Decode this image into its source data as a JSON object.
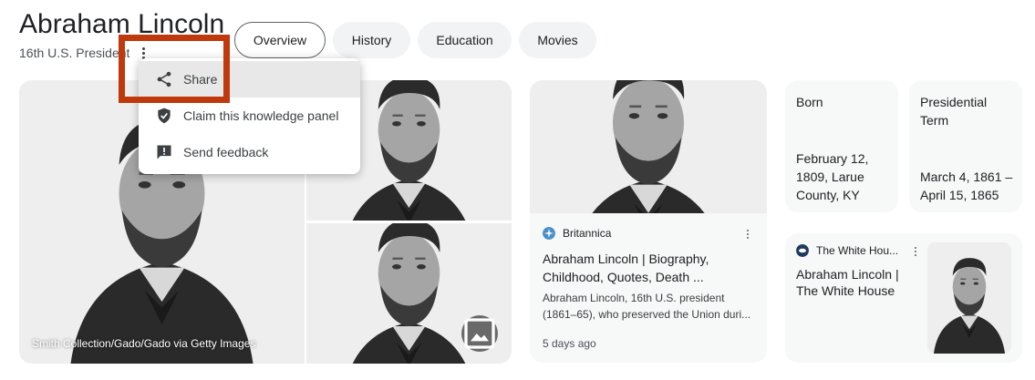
{
  "header": {
    "title": "Abraham Lincoln",
    "subtitle": "16th U.S. President",
    "tabs": [
      {
        "label": "Overview",
        "active": true
      },
      {
        "label": "History",
        "active": false
      },
      {
        "label": "Education",
        "active": false
      },
      {
        "label": "Movies",
        "active": false
      }
    ]
  },
  "menu": {
    "items": [
      {
        "label": "Share",
        "icon": "share-icon",
        "hovered": true
      },
      {
        "label": "Claim this knowledge panel",
        "icon": "verified-shield-icon"
      },
      {
        "label": "Send feedback",
        "icon": "feedback-icon"
      }
    ]
  },
  "images": {
    "main_caption": "Smith Collection/Gado/Gado via Getty Images"
  },
  "news": {
    "source": "Britannica",
    "title": "Abraham Lincoln | Biography, Childhood, Quotes, Death ...",
    "snippet": "Abraham Lincoln, 16th U.S. president (1861–65), who preserved the Union duri...",
    "time": "5 days ago"
  },
  "facts": {
    "born": {
      "label": "Born",
      "value": "February 12, 1809, Larue County, KY"
    },
    "term": {
      "label": "Presidential Term",
      "value": "March 4, 1861 – April 15, 1865"
    }
  },
  "whitehouse": {
    "source": "The White Hou...",
    "title": "Abraham Lincoln | The White House"
  },
  "colors": {
    "highlight": "#c0390c",
    "tab_bg": "#f1f3f4",
    "card_bg": "#f7f8f8"
  }
}
